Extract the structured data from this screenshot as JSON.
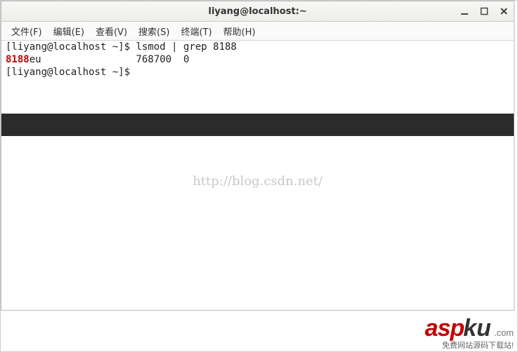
{
  "window": {
    "title": "liyang@localhost:~"
  },
  "menubar": {
    "items": [
      {
        "label": "文件(F)"
      },
      {
        "label": "编辑(E)"
      },
      {
        "label": "查看(V)"
      },
      {
        "label": "搜索(S)"
      },
      {
        "label": "终端(T)"
      },
      {
        "label": "帮助(H)"
      }
    ]
  },
  "terminal": {
    "prompt1": "[liyang@localhost ~]$ ",
    "cmd1": "lsmod | grep 8188",
    "out_hl": "8188",
    "out_rest": "eu                768700  0",
    "prompt2": "[liyang@localhost ~]$ "
  },
  "watermark": "http://blog.csdn.net/",
  "brand": {
    "logo_a": "asp",
    "logo_b": "ku",
    "logo_c": ".com",
    "tagline": "免费网站源码下载站!"
  }
}
